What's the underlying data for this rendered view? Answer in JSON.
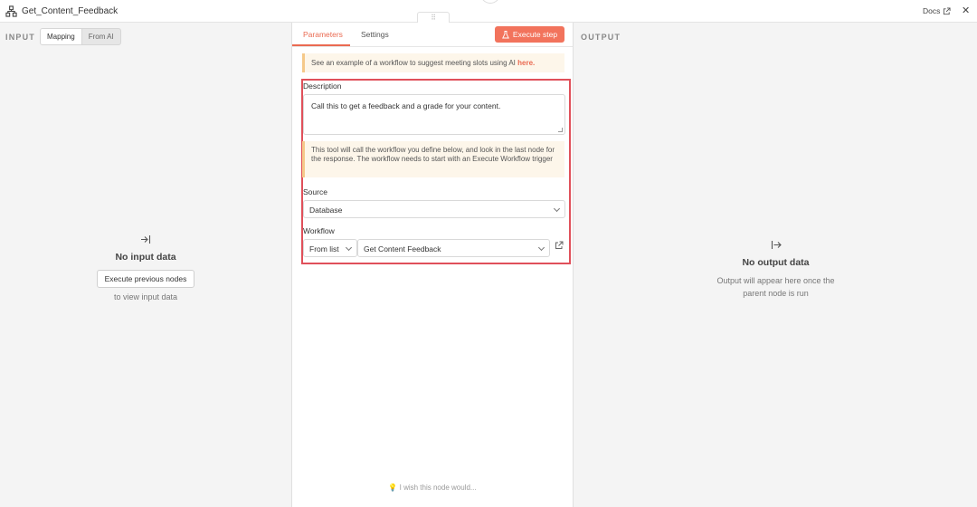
{
  "header": {
    "node_title": "Get_Content_Feedback",
    "docs_label": "Docs",
    "close_icon": "close-icon"
  },
  "input": {
    "label": "INPUT",
    "mode_tabs": [
      "Mapping",
      "From AI"
    ],
    "empty_title": "No input data",
    "execute_previous_label": "Execute previous nodes",
    "empty_sub": "to view input data"
  },
  "center": {
    "drag_handle": "⠿",
    "tabs": [
      "Parameters",
      "Settings"
    ],
    "execute_label": "Execute step",
    "example_notice_text": "See an example of a workflow to suggest meeting slots using AI",
    "example_notice_link": "here.",
    "description_label": "Description",
    "description_value": "Call this to get a feedback and a grade for your content.",
    "tool_notice": "This tool will call the workflow you define below, and look in the last node for the response. The workflow needs to start with an Execute Workflow trigger",
    "source_label": "Source",
    "source_value": "Database",
    "workflow_label": "Workflow",
    "workflow_mode": "From list",
    "workflow_value": "Get Content Feedback",
    "wish_text": "I wish this node would..."
  },
  "output": {
    "label": "OUTPUT",
    "empty_title": "No output data",
    "empty_sub_1": "Output will appear here once the",
    "empty_sub_2": "parent node is run"
  },
  "colors": {
    "accent": "#f2735c",
    "highlight_border": "#e0505a",
    "notice_bg": "#fdf6ea"
  }
}
